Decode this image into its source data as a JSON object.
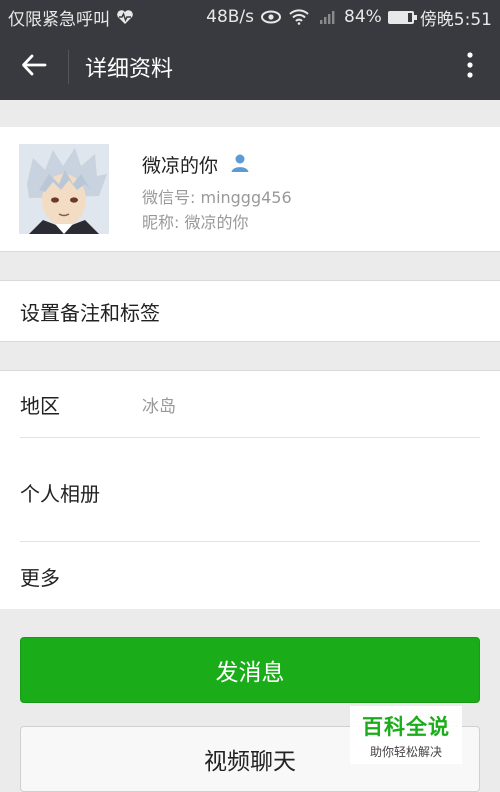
{
  "status_bar": {
    "carrier": "仅限紧急呼叫",
    "speed": "48B/s",
    "battery": "84%",
    "battery_level": 0.84,
    "time": "傍晚5:51"
  },
  "app_bar": {
    "title": "详细资料"
  },
  "profile": {
    "name": "微凉的你",
    "wechat_id": "微信号: minggg456",
    "nickname": "昵称: 微凉的你"
  },
  "remark": {
    "label": "设置备注和标签"
  },
  "info": {
    "region_label": "地区",
    "region_value": "冰岛",
    "album_label": "个人相册",
    "more_label": "更多"
  },
  "actions": {
    "send_message": "发消息",
    "video_chat": "视频聊天"
  },
  "watermark": {
    "title": "百科全说",
    "subtitle": "助你轻松解决"
  },
  "colors": {
    "bar": "#393a3f",
    "primary_green": "#1aad19",
    "background": "#ebebeb"
  },
  "icons": [
    "heart-pulse-icon",
    "eye-icon",
    "wifi-icon",
    "signal-icon",
    "battery-icon",
    "back-arrow-icon",
    "more-vertical-icon",
    "contact-person-icon"
  ]
}
